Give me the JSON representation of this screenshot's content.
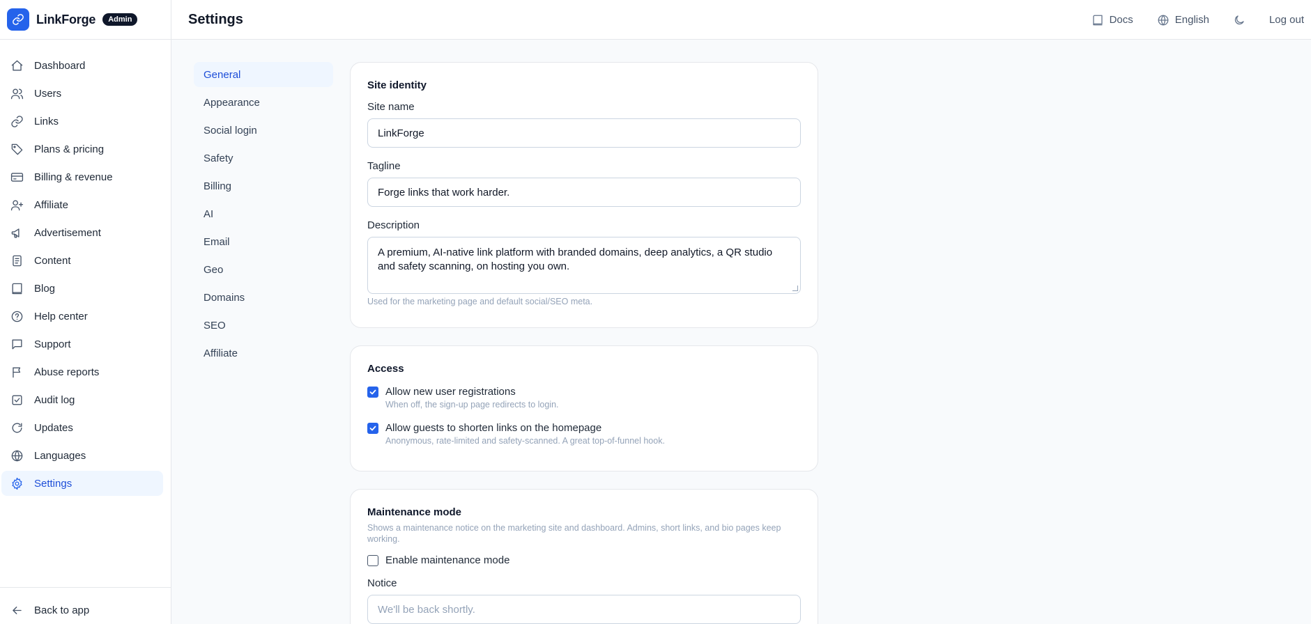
{
  "brand": {
    "name": "LinkForge",
    "badge": "Admin"
  },
  "sidebar": {
    "items": [
      {
        "label": "Dashboard",
        "icon": "home-icon"
      },
      {
        "label": "Users",
        "icon": "users-icon"
      },
      {
        "label": "Links",
        "icon": "link-icon"
      },
      {
        "label": "Plans & pricing",
        "icon": "tag-icon"
      },
      {
        "label": "Billing & revenue",
        "icon": "credit-card-icon"
      },
      {
        "label": "Affiliate",
        "icon": "user-plus-icon"
      },
      {
        "label": "Advertisement",
        "icon": "megaphone-icon"
      },
      {
        "label": "Content",
        "icon": "document-icon"
      },
      {
        "label": "Blog",
        "icon": "book-icon"
      },
      {
        "label": "Help center",
        "icon": "help-circle-icon"
      },
      {
        "label": "Support",
        "icon": "message-icon"
      },
      {
        "label": "Abuse reports",
        "icon": "flag-icon"
      },
      {
        "label": "Audit log",
        "icon": "checklist-icon"
      },
      {
        "label": "Updates",
        "icon": "refresh-icon"
      },
      {
        "label": "Languages",
        "icon": "globe-icon"
      },
      {
        "label": "Settings",
        "icon": "gear-icon",
        "active": true
      }
    ],
    "back_label": "Back to app"
  },
  "header": {
    "title": "Settings",
    "docs_label": "Docs",
    "language_label": "English",
    "logout_label": "Log out"
  },
  "subnav": {
    "items": [
      "General",
      "Appearance",
      "Social login",
      "Safety",
      "Billing",
      "AI",
      "Email",
      "Geo",
      "Domains",
      "SEO",
      "Affiliate"
    ],
    "active": "General"
  },
  "site_identity": {
    "title": "Site identity",
    "site_name_label": "Site name",
    "site_name_value": "LinkForge",
    "tagline_label": "Tagline",
    "tagline_value": "Forge links that work harder.",
    "description_label": "Description",
    "description_value": "A premium, AI-native link platform with branded domains, deep analytics, a QR studio and safety scanning, on hosting you own.",
    "description_help": "Used for the marketing page and default social/SEO meta."
  },
  "access": {
    "title": "Access",
    "registrations_label": "Allow new user registrations",
    "registrations_help": "When off, the sign-up page redirects to login.",
    "registrations_checked": true,
    "guests_label": "Allow guests to shorten links on the homepage",
    "guests_help": "Anonymous, rate-limited and safety-scanned. A great top-of-funnel hook.",
    "guests_checked": true
  },
  "maintenance": {
    "title": "Maintenance mode",
    "description": "Shows a maintenance notice on the marketing site and dashboard. Admins, short links, and bio pages keep working.",
    "enable_label": "Enable maintenance mode",
    "enable_checked": false,
    "notice_label": "Notice",
    "notice_placeholder": "We'll be back shortly."
  },
  "colors": {
    "accent": "#2563eb",
    "active_bg": "#eff6ff",
    "border": "#e5e7eb"
  }
}
